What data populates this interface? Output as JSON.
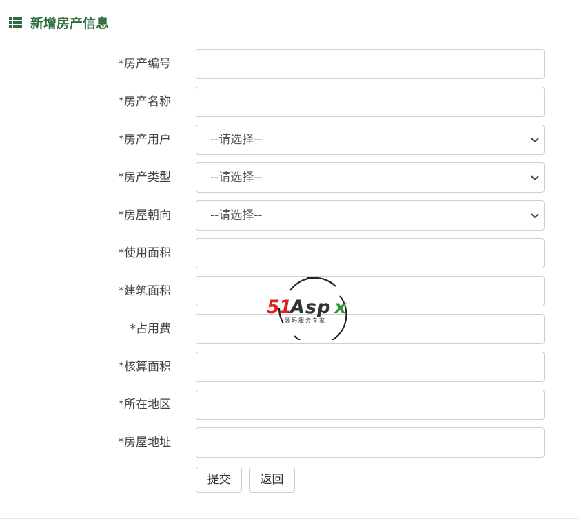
{
  "header": {
    "title": "新增房产信息",
    "icon": "list-icon",
    "accent_color": "#2e6b3d"
  },
  "form": {
    "fields": [
      {
        "label": "*房产编号",
        "type": "text",
        "value": ""
      },
      {
        "label": "*房产名称",
        "type": "text",
        "value": ""
      },
      {
        "label": "*房产用户",
        "type": "select",
        "selected": "--请选择--"
      },
      {
        "label": "*房产类型",
        "type": "select",
        "selected": "--请选择--"
      },
      {
        "label": "*房屋朝向",
        "type": "select",
        "selected": "--请选择--"
      },
      {
        "label": "*使用面积",
        "type": "text",
        "value": ""
      },
      {
        "label": "*建筑面积",
        "type": "text",
        "value": ""
      },
      {
        "label": "*占用费",
        "type": "text",
        "value": ""
      },
      {
        "label": "*核算面积",
        "type": "text",
        "value": ""
      },
      {
        "label": "*所在地区",
        "type": "text",
        "value": ""
      },
      {
        "label": "*房屋地址",
        "type": "text",
        "value": ""
      }
    ],
    "submit_label": "提交",
    "back_label": "返回"
  },
  "watermark": {
    "brand_red": "51",
    "brand_dark": "Asp",
    "brand_green": "x",
    "tagline": "源码服务专家"
  }
}
